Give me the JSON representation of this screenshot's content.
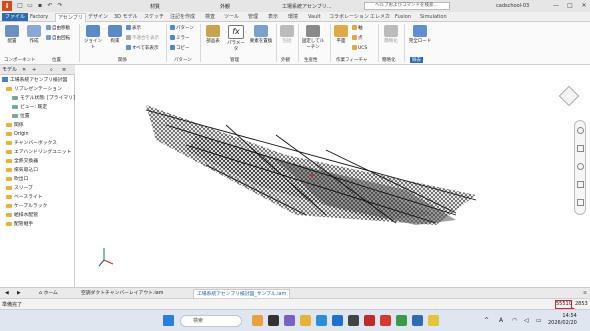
{
  "titlebar": {
    "logo": "I",
    "document_title": "工場系統アセンブリ...",
    "search_placeholder": "ヘルプおよびコマンドを検索...",
    "user": "cadschool-03",
    "quick_access": {
      "material": "材質",
      "appearance": "外観"
    }
  },
  "tabs": [
    "ファイル",
    "Factory",
    "アセンブリ",
    "デザイン",
    "3D モデル",
    "スケッチ",
    "注記を作成",
    "検査",
    "ツール",
    "管理",
    "表示",
    "環境",
    "Vault",
    "コラボレーション",
    "エレメカ",
    "Fusion",
    "Simulation"
  ],
  "ribbon": {
    "component": {
      "place": "配置",
      "create": "作成",
      "group": "コンポーネント"
    },
    "position": {
      "free_move": "自由移動",
      "free_rotate": "自由回転",
      "group": "位置"
    },
    "relationships": {
      "joint": "ジョイント",
      "constrain": "拘束",
      "show": "表示",
      "show_sick": "不適合を表示",
      "hide_all": "すべて非表示",
      "group": "関係"
    },
    "pattern": {
      "pattern": "パターン",
      "mirror": "ミラー",
      "copy": "コピー",
      "group": "パターン"
    },
    "manage": {
      "bom": "部品表",
      "parameters": "パラメータ",
      "replace": "置換",
      "group": "管理"
    },
    "express_bom": "要素を置換",
    "shrinkwrap": {
      "label": "包括",
      "group": "外観"
    },
    "productivity": {
      "label": "固定してルーチン",
      "group": "生産性"
    },
    "work_features": {
      "plane": "平面",
      "axis": "軸",
      "point": "点",
      "ucs": "UCS",
      "group": "作業フィーチャ"
    },
    "simplify": {
      "label": "簡略化",
      "group": "簡略化"
    },
    "load": {
      "label": "完全ロード",
      "group": "除去"
    }
  },
  "browser": {
    "header": "モデル",
    "root": "工場系統アセンブリ検討図",
    "items": [
      "リプレゼンテーション",
      "モデル状態: [プライマリ]",
      "ビュー: 既定",
      "位置",
      "関係",
      "Origin",
      "チャンバーボックス",
      "エアハンドリングユニット",
      "全熱交換器",
      "排気吸込口",
      "吹出口",
      "スリーブ",
      "ベースライト",
      "ケーブルラック",
      "給排水配管",
      "配管継手"
    ]
  },
  "doc_tabs": {
    "home": "ホーム",
    "tab1": "空調ダクトチャンバーレイアウト.iam",
    "tab2": "工場系統アセンブリ検討図_サンプル.iam"
  },
  "status": {
    "text": "準備完了",
    "count1": "55510",
    "count2": "2853"
  },
  "taskbar": {
    "search": "検索",
    "time": "14:54",
    "date": "2026/02/20",
    "lang": "A"
  }
}
